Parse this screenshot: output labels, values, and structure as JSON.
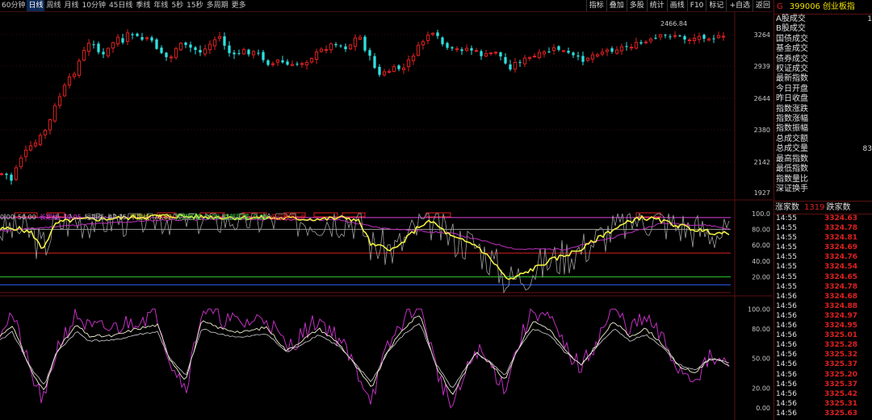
{
  "toolbar": {
    "periods": [
      "60分钟",
      "日线",
      "周线",
      "月线",
      "10分钟",
      "45日线",
      "季线",
      "年线",
      "5秒",
      "15秒",
      "多周期",
      "更多"
    ],
    "active_period": "日线",
    "actions": [
      "指标",
      "叠加",
      "多股",
      "统计",
      "画线",
      "F10",
      "标记",
      "+自选",
      "返回"
    ]
  },
  "price_panel": {
    "max_label": "2466.84",
    "y_ticks": [
      "3264",
      "2939",
      "2644",
      "2380",
      "2142",
      "1927"
    ]
  },
  "indicator_legend": [
    {
      "text": "0.00",
      "color": "#c0c0c0"
    },
    {
      "text": "50.00",
      "color": "#c0c0c0"
    },
    {
      "text": "长期线: 79.05",
      "color": "#e040e0"
    },
    {
      "text": "短期线: 47.75",
      "color": "#c0c0c0"
    },
    {
      "text": "中期线: 70.82",
      "color": "#f0f040"
    },
    {
      "text": "顶部区域: 0.00",
      "color": "#40e040"
    },
    {
      "text": "底部区域: 0.00",
      "color": "#40e040"
    },
    {
      "text": "低位金叉: 0",
      "color": "#e02020"
    }
  ],
  "indicator1": {
    "y_ticks": [
      "100.0",
      "80.00",
      "60.00",
      "40.00",
      "20.00"
    ]
  },
  "indicator2": {
    "y_ticks": [
      "100.00",
      "80.00",
      "50.00",
      "20.00",
      "0.00"
    ]
  },
  "right_panel": {
    "marker": "G",
    "code": "399006",
    "name": "创业板指",
    "side_numbers": [
      "1",
      "83"
    ],
    "items": [
      "A股成交",
      "B股成交",
      "国债成交",
      "基金成交",
      "债券成交",
      "权证成交",
      "最新指数",
      "今日开盘",
      "昨日收盘",
      "指数涨跌",
      "指数涨幅",
      "指数振幅",
      "总成交额",
      "总成交量",
      "最高指数",
      "最低指数",
      "指数量比",
      "深证换手"
    ],
    "breadth": {
      "up_label": "涨家数",
      "up_count": "1319",
      "down_label": "跌家数"
    },
    "ticks": [
      {
        "t": "14:55",
        "v": "3324.63"
      },
      {
        "t": "14:55",
        "v": "3324.78"
      },
      {
        "t": "14:55",
        "v": "3324.81"
      },
      {
        "t": "14:55",
        "v": "3324.69"
      },
      {
        "t": "14:55",
        "v": "3324.76"
      },
      {
        "t": "14:55",
        "v": "3324.54"
      },
      {
        "t": "14:55",
        "v": "3324.65"
      },
      {
        "t": "14:55",
        "v": "3324.78"
      },
      {
        "t": "14:56",
        "v": "3324.68"
      },
      {
        "t": "14:56",
        "v": "3324.88"
      },
      {
        "t": "14:56",
        "v": "3324.97"
      },
      {
        "t": "14:56",
        "v": "3324.95"
      },
      {
        "t": "14:56",
        "v": "3325.01"
      },
      {
        "t": "14:56",
        "v": "3325.28"
      },
      {
        "t": "14:56",
        "v": "3325.32"
      },
      {
        "t": "14:56",
        "v": "3325.37"
      },
      {
        "t": "14:56",
        "v": "3325.20"
      },
      {
        "t": "14:56",
        "v": "3325.37"
      },
      {
        "t": "14:56",
        "v": "3325.42"
      },
      {
        "t": "14:56",
        "v": "3325.31"
      },
      {
        "t": "14:56",
        "v": "3325.63"
      }
    ]
  },
  "colors": {
    "up": "#e02020",
    "down": "#30e0e0",
    "ma_short": "#c0c0c0",
    "ma_mid": "#f0f040",
    "ma_long": "#e040e0"
  }
}
